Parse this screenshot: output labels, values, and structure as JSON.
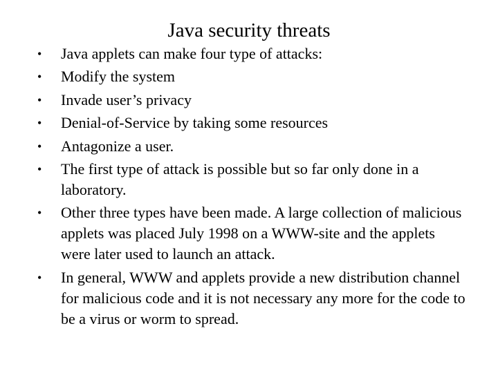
{
  "slide": {
    "title": "Java security threats",
    "bullets": [
      "Java applets can make four type of attacks:",
      "Modify the system",
      "Invade user’s privacy",
      "Denial-of-Service by taking some resources",
      "Antagonize a user.",
      "The first type of attack is possible but so far only done in a laboratory.",
      "Other three types have been made. A large collection of malicious applets was placed July 1998 on a WWW-site and the applets were later used to launch an attack.",
      "In general, WWW and applets provide a new distribution channel for malicious code and it is not necessary any more for the code to be a virus or worm to spread."
    ],
    "bullet_glyph": "•"
  }
}
